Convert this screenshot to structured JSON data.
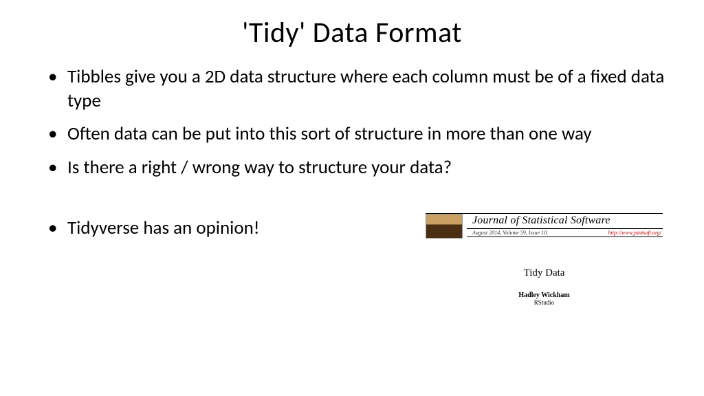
{
  "title": "'Tidy' Data Format",
  "bullets": {
    "b1": "Tibbles give you a 2D data structure where each column must be of a fixed data type",
    "b2": "Often data can be put into this sort of structure in more than one way",
    "b3": "Is there a right / wrong way to structure your data?",
    "b4": "Tidyverse has an opinion!"
  },
  "paper": {
    "journal": "Journal of Statistical Software",
    "issue": "August 2014, Volume 59, Issue 10.",
    "url": "http://www.jstatsoft.org/",
    "article_title": "Tidy Data",
    "author": "Hadley Wickham",
    "affiliation": "RStudio"
  }
}
